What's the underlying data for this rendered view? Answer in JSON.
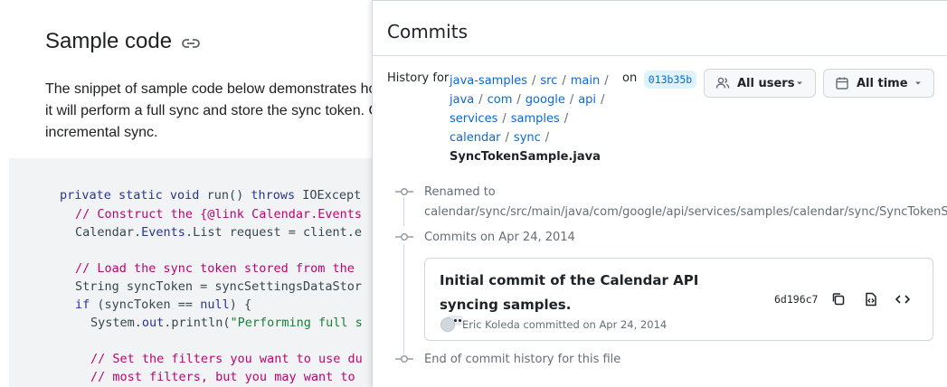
{
  "doc": {
    "title": "Sample code",
    "paragraph_lines": [
      "The snippet of sample code below demonstrates ho",
      "it will perform a full sync and store the sync token. O",
      "incremental sync."
    ]
  },
  "code": {
    "l1_kw": "private static void",
    "l1_rest": " run() ",
    "l1_kw2": "throws",
    "l1_tail": " IOExcept",
    "l2": "// Construct the {@link Calendar.Events",
    "l3_a": "Calendar.",
    "l3_b": "Events",
    "l3_c": ".List request = client.e",
    "l5": "// Load the sync token stored from the",
    "l6": "String syncToken = syncSettingsDataStor",
    "l7_kw": "if",
    "l7_rest": " (syncToken == ",
    "l7_null": "null",
    "l7_tail": ") {",
    "l8_a": "System.",
    "l8_b": "out",
    "l8_c": ".println(",
    "l8_str": "\"Performing full s",
    "l10": "// Set the filters you want to use du",
    "l11": "// most filters, but you may want to"
  },
  "panel": {
    "title": "Commits",
    "history_for": "History for",
    "breadcrumbs": [
      "java-samples",
      "src",
      "main",
      "java",
      "com",
      "google",
      "api",
      "services",
      "samples",
      "calendar",
      "sync"
    ],
    "file": "SyncTokenSample.java",
    "on": "on",
    "ref": "013b35b",
    "users_button": "All users",
    "time_button": "All time",
    "renamed_label": "Renamed to",
    "renamed_path": "calendar/sync/src/main/java/com/google/api/services/samples/calendar/sync/SyncTokenSampl",
    "commits_on": "Commits on Apr 24, 2014",
    "end_label": "End of commit history for this file"
  },
  "commit": {
    "title_line1": "Initial commit of the Calendar API",
    "title_line2": "syncing samples.",
    "sha": "6d196c7",
    "author": "Eric Koleda",
    "committed_text": "committed on Apr 24, 2014"
  },
  "colors": {
    "link": "#0969da",
    "sha_chip_bg": "#ddf4ff",
    "code_bg": "#f1f3f4",
    "code_keyword": "#283593",
    "code_comment": "#b80672",
    "code_string": "#188038"
  }
}
